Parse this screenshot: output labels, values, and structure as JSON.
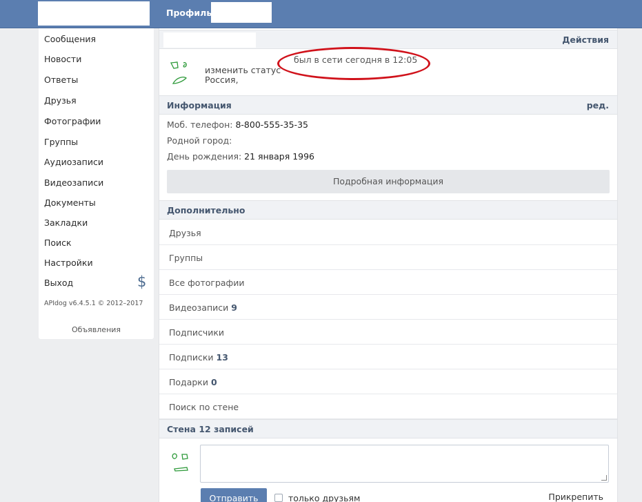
{
  "header": {
    "title": "Профиль"
  },
  "sidebar": {
    "items": [
      {
        "label": "Сообщения"
      },
      {
        "label": "Новости"
      },
      {
        "label": "Ответы"
      },
      {
        "label": "Друзья"
      },
      {
        "label": "Фотографии"
      },
      {
        "label": "Группы"
      },
      {
        "label": "Аудиозаписи"
      },
      {
        "label": "Видеозаписи"
      },
      {
        "label": "Документы"
      },
      {
        "label": "Закладки"
      },
      {
        "label": "Поиск"
      },
      {
        "label": "Настройки"
      },
      {
        "label": "Выход"
      }
    ],
    "dollar": "$",
    "version": "APIdog v6.4.5.1 © 2012–2017",
    "ads": "Объявления"
  },
  "profile": {
    "actions": "Действия",
    "change_status": "изменить статус",
    "country": "Россия,",
    "online": "был в сети сегодня в 12:05"
  },
  "info": {
    "title": "Информация",
    "edit": "ред.",
    "phone_label": "Моб. телефон:",
    "phone_value": "8-800-555-35-35",
    "hometown_label": "Родной город:",
    "birthday_label": "День рождения:",
    "birthday_value": "21 января 1996",
    "more_button": "Подробная информация"
  },
  "extra": {
    "title": "Дополнительно",
    "rows": [
      {
        "label": "Друзья",
        "count": ""
      },
      {
        "label": "Группы",
        "count": ""
      },
      {
        "label": "Все фотографии",
        "count": ""
      },
      {
        "label": "Видеозаписи",
        "count": "9"
      },
      {
        "label": "Подписчики",
        "count": ""
      },
      {
        "label": "Подписки",
        "count": "13"
      },
      {
        "label": "Подарки",
        "count": "0"
      },
      {
        "label": "Поиск по стене",
        "count": ""
      }
    ]
  },
  "wall": {
    "title": "Стена 12 записей",
    "send": "Отправить",
    "friends_only": "только друзьям",
    "attach": "Прикрепить"
  }
}
